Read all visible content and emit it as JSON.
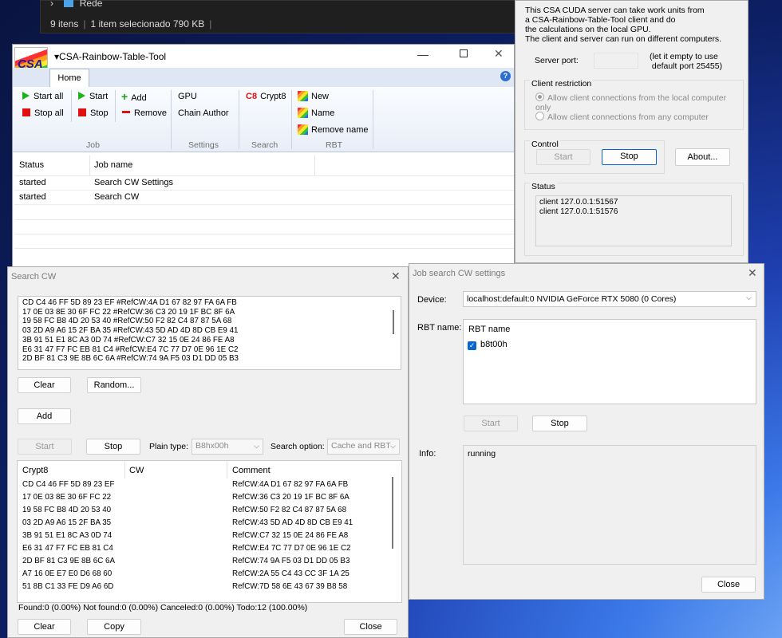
{
  "explorer": {
    "nav_item": "Rede",
    "status_items": "9 itens",
    "status_selected": "1 item selecionado  790 KB"
  },
  "server": {
    "description": "This CSA CUDA server can take work units from\na CSA-Rainbow-Table-Tool client and do\nthe calculations on the local GPU.\nThe client and server can run on different computers.",
    "port_label": "Server port:",
    "port_value": "",
    "port_hint": "(let it empty to use\n default port 25455)",
    "restriction_title": "Client restriction",
    "restriction_local": "Allow client connections from the local computer only",
    "restriction_any": "Allow client connections from any computer",
    "control_title": "Control",
    "start_label": "Start",
    "stop_label": "Stop",
    "about_label": "About...",
    "status_title": "Status",
    "status_lines": "client 127.0.0.1:51567\nclient 127.0.0.1:51576"
  },
  "rtool": {
    "title": "CSA-Rainbow-Table-Tool",
    "tab_home": "Home",
    "job": {
      "start_all": "Start all",
      "stop_all": "Stop all",
      "start": "Start",
      "stop": "Stop",
      "add": "Add",
      "remove": "Remove",
      "group": "Job"
    },
    "settings": {
      "gpu": "GPU",
      "chain_author": "Chain Author",
      "group": "Settings"
    },
    "search": {
      "crypt8": "Crypt8",
      "group": "Search"
    },
    "rbt": {
      "new": "New",
      "name": "Name",
      "remove_name": "Remove name",
      "group": "RBT"
    },
    "columns": {
      "status": "Status",
      "job_name": "Job name"
    },
    "rows": [
      {
        "status": "started",
        "job_name": "Search CW Settings"
      },
      {
        "status": "started",
        "job_name": "Search CW"
      }
    ]
  },
  "searchcw": {
    "title": "Search CW",
    "input_text": "CD C4 46 FF 5D 89 23 EF #RefCW:4A D1 67 82 97 FA 6A FB\n17 0E 03 8E 30 6F FC 22 #RefCW:36 C3 20 19 1F BC 8F 6A\n19 58 FC B8 4D 20 53 40 #RefCW:50 F2 82 C4 87 87 5A 68\n03 2D A9 A6 15 2F BA 35 #RefCW:43 5D AD 4D 8D CB E9 41\n3B 91 51 E1 8C A3 0D 74 #RefCW:C7 32 15 0E 24 86 FE A8\nE6 31 47 F7 FC EB 81 C4 #RefCW:E4 7C 77 D7 0E 96 1E C2\n2D BF 81 C3 9E 8B 6C 6A #RefCW:74 9A F5 03 D1 DD 05 B3",
    "clear": "Clear",
    "random": "Random...",
    "add": "Add",
    "start": "Start",
    "stop": "Stop",
    "plain_type_label": "Plain type:",
    "plain_type_value": "B8hx00h",
    "search_option_label": "Search option:",
    "search_option_value": "Cache and RBT",
    "columns": {
      "crypt8": "Crypt8",
      "cw": "CW",
      "comment": "Comment"
    },
    "results": [
      {
        "crypt8": "CD C4 46 FF 5D 89 23 EF",
        "cw": "",
        "comment": "RefCW:4A D1 67 82 97 FA 6A FB"
      },
      {
        "crypt8": "17 0E 03 8E 30 6F FC 22",
        "cw": "",
        "comment": "RefCW:36 C3 20 19 1F BC 8F 6A"
      },
      {
        "crypt8": "19 58 FC B8 4D 20 53 40",
        "cw": "",
        "comment": "RefCW:50 F2 82 C4 87 87 5A 68"
      },
      {
        "crypt8": "03 2D A9 A6 15 2F BA 35",
        "cw": "",
        "comment": "RefCW:43 5D AD 4D 8D CB E9 41"
      },
      {
        "crypt8": "3B 91 51 E1 8C A3 0D 74",
        "cw": "",
        "comment": "RefCW:C7 32 15 0E 24 86 FE A8"
      },
      {
        "crypt8": "E6 31 47 F7 FC EB 81 C4",
        "cw": "",
        "comment": "RefCW:E4 7C 77 D7 0E 96 1E C2"
      },
      {
        "crypt8": "2D BF 81 C3 9E 8B 6C 6A",
        "cw": "",
        "comment": "RefCW:74 9A F5 03 D1 DD 05 B3"
      },
      {
        "crypt8": "A7 16 0E E7 E0 D6 68 60",
        "cw": "",
        "comment": "RefCW:2A 55 C4 43 CC 3F 1A 25"
      },
      {
        "crypt8": "51 8B C1 33 FE D9 A6 6D",
        "cw": "",
        "comment": "RefCW:7D 58 6E 43 67 39 B8 58"
      }
    ],
    "status_line": "Found:0 (0.00%)  Not found:0 (0.00%)  Canceled:0 (0.00%)  Todo:12 (100.00%)",
    "copy": "Copy",
    "close": "Close"
  },
  "jobwin": {
    "title": "Job search CW settings",
    "device_label": "Device:",
    "device_value": "localhost:default:0 NVIDIA GeForce RTX 5080 (0 Cores)",
    "rbt_label": "RBT name:",
    "rbt_column": "RBT name",
    "rbt_item": "b8t00h",
    "start": "Start",
    "stop": "Stop",
    "info_label": "Info:",
    "info_value": "running",
    "close": "Close"
  },
  "colors": {
    "accent": "#0a64d2",
    "play_green": "#1cb31c",
    "stop_red": "#e01010"
  }
}
